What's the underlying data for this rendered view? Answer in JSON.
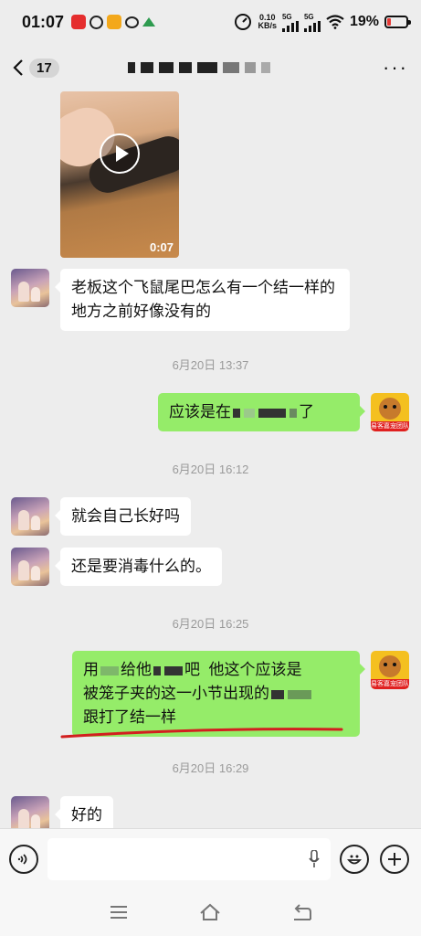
{
  "status_bar": {
    "time": "01:07",
    "net_speed_value": "0.10",
    "net_speed_unit": "KB/s",
    "signal1_label": "5G",
    "signal2_label": "5G",
    "battery_percent": "19%",
    "battery_level": 0.19,
    "icons": [
      "red-app-icon",
      "link-app-icon",
      "yellow-app-icon",
      "wechat-icon",
      "green-app-icon",
      "speed-meter-icon",
      "wifi-icon"
    ]
  },
  "header": {
    "unread_count": "17",
    "back_icon": "chevron-left-icon",
    "more_icon": "more-dots-icon",
    "title_redacted": true
  },
  "messages": [
    {
      "type": "video",
      "side": "left",
      "duration": "0:07"
    },
    {
      "type": "text",
      "side": "left",
      "text": "老板这个飞鼠尾巴怎么有一个结一样的地方之前好像没有的"
    },
    {
      "type": "timestamp",
      "text": "6月20日 13:37"
    },
    {
      "type": "text",
      "side": "right",
      "prefix": "应该是在",
      "suffix": "了"
    },
    {
      "type": "timestamp",
      "text": "6月20日 16:12"
    },
    {
      "type": "text",
      "side": "left",
      "text": "就会自己长好吗"
    },
    {
      "type": "text",
      "side": "left",
      "text": "还是要消毒什么的。"
    },
    {
      "type": "timestamp",
      "text": "6月20日 16:25"
    },
    {
      "type": "text",
      "side": "right",
      "part1": "用",
      "part2": "给他",
      "part3": "吧",
      "part4": "他这个应该是",
      "line2a": "被笼子夹的这一小节出现的",
      "line3": "跟打了结一样"
    },
    {
      "type": "timestamp",
      "text": "6月20日 16:29"
    },
    {
      "type": "text",
      "side": "left",
      "text": "好的"
    }
  ],
  "right_avatar_banner": "易客嘉宠团队",
  "input_bar": {
    "voice_icon": "voice-icon",
    "mic_icon": "microphone-icon",
    "emoji_icon": "emoji-icon",
    "plus_icon": "plus-icon",
    "placeholder": ""
  },
  "nav_bar": {
    "icons": [
      "menu-icon",
      "home-icon",
      "back-icon"
    ]
  },
  "colors": {
    "background": "#ededed",
    "bubble_out": "#95ec69",
    "bubble_in": "#ffffff",
    "annotation": "#d21f1f"
  }
}
